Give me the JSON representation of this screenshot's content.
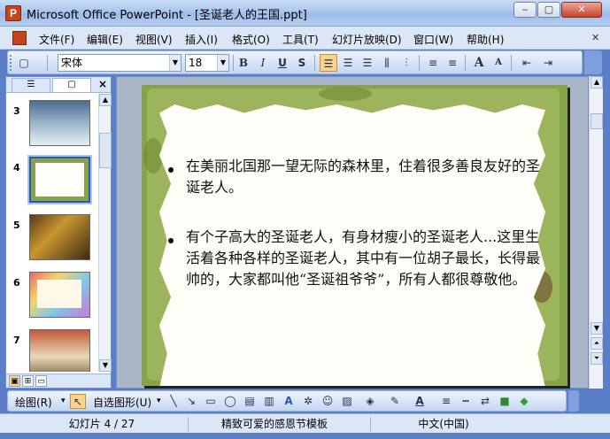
{
  "window": {
    "title": "Microsoft Office PowerPoint - [圣诞老人的王国.ppt]",
    "controls": {
      "minimize": "‒",
      "maximize": "▢",
      "close": "✕"
    }
  },
  "menubar": {
    "items": [
      "文件(F)",
      "编辑(E)",
      "视图(V)",
      "插入(I)",
      "格式(O)",
      "工具(T)",
      "幻灯片放映(D)",
      "窗口(W)",
      "帮助(H)"
    ],
    "close_doc": "✕"
  },
  "toolbar": {
    "font_name": "宋体",
    "font_size": "18",
    "bold": "B",
    "italic": "I",
    "underline": "U",
    "shadow": "S",
    "grow_font": "A",
    "shrink_font": "A"
  },
  "left_panel": {
    "tabs": [
      "outline",
      "slides"
    ],
    "thumbnails": [
      {
        "number": "3"
      },
      {
        "number": "4",
        "selected": true
      },
      {
        "number": "5"
      },
      {
        "number": "6"
      },
      {
        "number": "7"
      }
    ]
  },
  "slide": {
    "bullets": [
      "    在美丽北国那一望无际的森林里，住着很多善良友好的圣诞老人。",
      "    有个子高大的圣诞老人，有身材瘦小的圣诞老人...这里生活着各种各样的圣诞老人，其中有一位胡子最长，长得最帅的，大家都叫他“圣诞祖爷爷”，所有人都很尊敬他。"
    ]
  },
  "drawbar": {
    "draw_menu": "绘图(R)",
    "autoshapes": "自选图形(U)"
  },
  "statusbar": {
    "slide_info": "幻灯片 4 / 27",
    "template": "精致可爱的感恩节模板",
    "language": "中文(中国)"
  },
  "colors": {
    "slide_green": "#86a347",
    "accent_blue": "#5a7ec8",
    "selected_orange": "#fbd38c"
  }
}
